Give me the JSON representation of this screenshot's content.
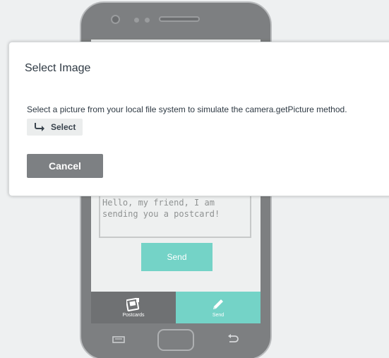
{
  "phone": {
    "screen": {
      "message_text": "Hello, my friend, I am sending you a postcard!",
      "send_button_label": "Send",
      "tabs": [
        {
          "label": "Postcards",
          "icon": "postcard-icon"
        },
        {
          "label": "Send",
          "icon": "pencil-icon"
        }
      ]
    },
    "hardware": {
      "menu_icon": "menu-icon",
      "home_icon": "home-button",
      "back_icon": "back-arrow-icon"
    }
  },
  "dialog": {
    "title": "Select Image",
    "description": "Select a picture from your local file system to simulate the camera.getPicture method.",
    "select_button_label": "Select",
    "select_icon": "share-arrow-icon",
    "cancel_button_label": "Cancel"
  },
  "colors": {
    "accent": "#74d3c7",
    "phone_body": "#7d7f81",
    "cancel_button": "#7d8083",
    "select_button": "#ebeded",
    "page_background": "#eef0f1"
  }
}
